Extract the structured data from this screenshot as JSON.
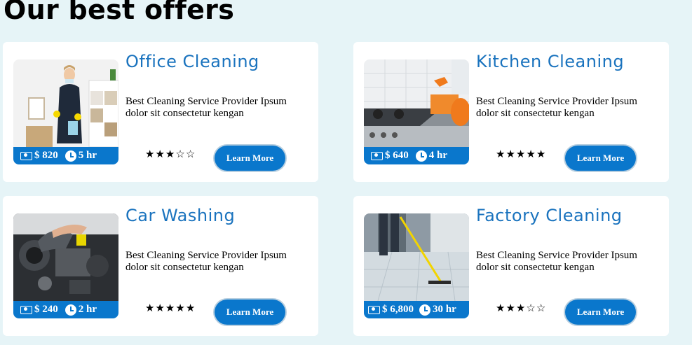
{
  "page": {
    "title": "Our best offers"
  },
  "offers": [
    {
      "title": "Office Cleaning",
      "description": "Best Cleaning Service Provider Ipsum dolor sit consectetur kengan",
      "price": "$ 820",
      "duration": "5 hr",
      "rating": 3,
      "button": "Learn More"
    },
    {
      "title": "Kitchen Cleaning",
      "description": "Best Cleaning Service Provider Ipsum dolor sit consectetur kengan",
      "price": "$ 640",
      "duration": "4 hr",
      "rating": 5,
      "button": "Learn More"
    },
    {
      "title": "Car Washing",
      "description": "Best Cleaning Service Provider Ipsum dolor sit consectetur kengan",
      "price": "$ 240",
      "duration": "2 hr",
      "rating": 5,
      "button": "Learn More"
    },
    {
      "title": "Factory Cleaning",
      "description": "Best Cleaning Service Provider Ipsum dolor sit consectetur kengan",
      "price": "$ 6,800",
      "duration": "30 hr",
      "rating": 3,
      "button": "Learn More"
    }
  ],
  "colors": {
    "accent": "#0a77cc",
    "title": "#1a73be",
    "background": "#e6f4f7"
  }
}
